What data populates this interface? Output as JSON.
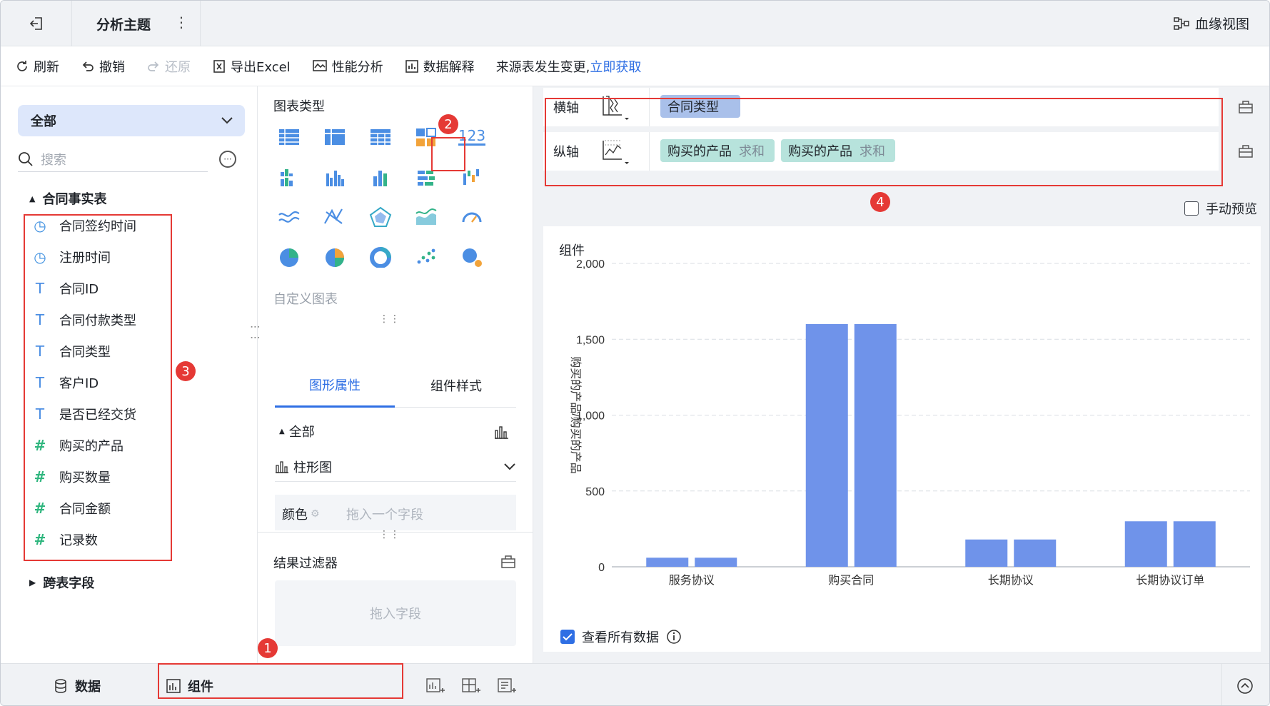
{
  "header": {
    "title": "分析主题",
    "more": "⋮",
    "lineage_label": "血缘视图"
  },
  "toolbar": {
    "refresh": "刷新",
    "undo": "撤销",
    "redo": "还原",
    "export_excel": "导出Excel",
    "performance": "性能分析",
    "data_explain": "数据解释",
    "source_changed": "来源表发生变更,",
    "fetch_now": "立即获取"
  },
  "left": {
    "scope": "全部",
    "search_placeholder": "搜索",
    "table_group": "合同事实表",
    "fields": [
      {
        "icon": "clock-icon",
        "label": "合同签约时间"
      },
      {
        "icon": "clock-icon",
        "label": "注册时间"
      },
      {
        "icon": "text-type-icon",
        "label": "合同ID"
      },
      {
        "icon": "text-type-icon",
        "label": "合同付款类型"
      },
      {
        "icon": "text-type-icon",
        "label": "合同类型"
      },
      {
        "icon": "text-type-icon",
        "label": "客户ID"
      },
      {
        "icon": "text-type-icon",
        "label": "是否已经交货"
      },
      {
        "icon": "number-type-icon",
        "label": "购买的产品"
      },
      {
        "icon": "number-type-icon",
        "label": "购买数量"
      },
      {
        "icon": "number-type-icon",
        "label": "合同金额"
      },
      {
        "icon": "record-count-icon",
        "label": "记录数"
      }
    ],
    "cross_table_group": "跨表字段"
  },
  "middle": {
    "chart_types_label": "图表类型",
    "number_chart_label": "123",
    "custom_chart_label": "自定义图表",
    "tabs": [
      "图形属性",
      "组件样式"
    ],
    "all_label": "全部",
    "chart_kind": "柱形图",
    "color_label": "颜色",
    "color_drop": "拖入一个字段",
    "filter_label": "结果过滤器",
    "filter_drop": "拖入字段"
  },
  "right": {
    "x_axis_label": "横轴",
    "y_axis_label": "纵轴",
    "x_pill": "合同类型",
    "y_pills": [
      {
        "field": "购买的产品",
        "agg": "求和"
      },
      {
        "field": "购买的产品",
        "agg": "求和"
      }
    ],
    "manual_preview": "手动预览",
    "view_all_data": "查看所有数据",
    "card_title": "组件"
  },
  "bottom": {
    "data_tab": "数据",
    "component_tab": "组件"
  },
  "annotations": [
    "1",
    "2",
    "3",
    "4"
  ],
  "colors": {
    "accent": "#2f6fe4",
    "bar": "#6f93ea",
    "annotation": "#e53935"
  },
  "chart_data": {
    "type": "bar",
    "categories": [
      "服务协议",
      "购买合同",
      "长期协议",
      "长期协议订单"
    ],
    "series": [
      {
        "values": [
          60,
          1600,
          180,
          300
        ]
      },
      {
        "values": [
          60,
          1600,
          180,
          300
        ]
      }
    ],
    "ylabel": "购买的产品/购买的产品",
    "ylim": [
      0,
      2000
    ],
    "yticks": [
      "0",
      "500",
      "1,000",
      "1,500",
      "2,000"
    ],
    "grid": true
  }
}
